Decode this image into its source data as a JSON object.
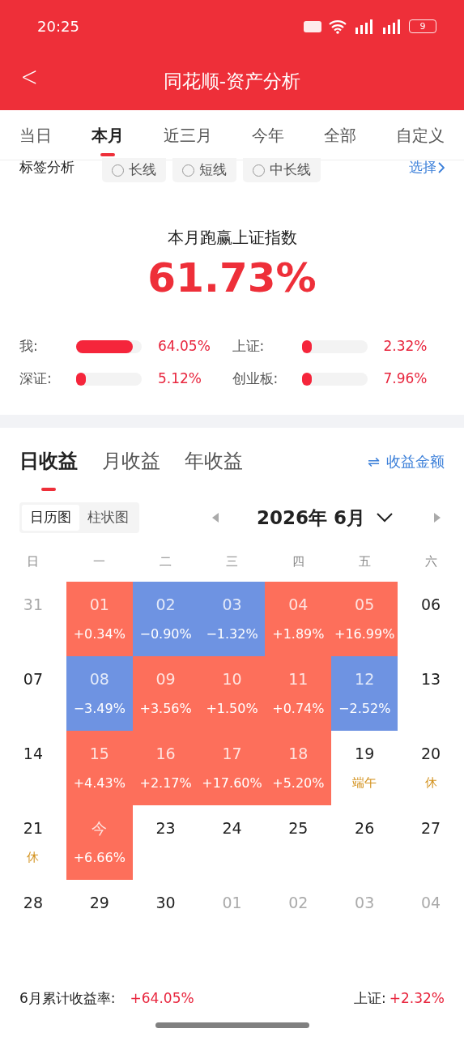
{
  "status_bar": {
    "time": "20:25",
    "battery": "9"
  },
  "header": {
    "back": "<",
    "title": "同花顺-资产分析"
  },
  "period_tabs": [
    {
      "label": "当日",
      "selected": false
    },
    {
      "label": "本月",
      "selected": true
    },
    {
      "label": "近三月",
      "selected": false
    },
    {
      "label": "今年",
      "selected": false
    },
    {
      "label": "全部",
      "selected": false
    },
    {
      "label": "自定义",
      "selected": false
    }
  ],
  "tag_filter": {
    "label": "标签分析",
    "options": [
      {
        "label": "长线",
        "checked": false
      },
      {
        "label": "短线",
        "checked": false
      },
      {
        "label": "中长线",
        "checked": false
      }
    ],
    "select": "选择"
  },
  "summary": {
    "title": "本月跑赢上证指数",
    "value": "61.73%"
  },
  "comparisons": [
    {
      "name": "我:",
      "level": 0.86,
      "value": "64.05%"
    },
    {
      "name": "上证:",
      "level": 0.15,
      "value": "2.32%"
    },
    {
      "name": "深证:",
      "level": 0.15,
      "value": "5.12%"
    },
    {
      "name": "创业板:",
      "level": 0.15,
      "value": "7.96%"
    }
  ],
  "income_tabs": [
    {
      "label": "日收益",
      "selected": true
    },
    {
      "label": "月收益",
      "selected": false
    },
    {
      "label": "年收益",
      "selected": false
    }
  ],
  "switch_link": {
    "icon": "⇌",
    "label": "收益金额"
  },
  "view_toggle": [
    {
      "label": "日历图",
      "selected": true
    },
    {
      "label": "柱状图",
      "selected": false
    }
  ],
  "month": "2026年 6月",
  "weekdays": [
    "日",
    "一",
    "二",
    "三",
    "四",
    "五",
    "六"
  ],
  "calendar": [
    {
      "day": "31",
      "kind": "other"
    },
    {
      "day": "01",
      "kind": "up",
      "change": "+0.34%"
    },
    {
      "day": "02",
      "kind": "down",
      "change": "−0.90%"
    },
    {
      "day": "03",
      "kind": "down",
      "change": "−1.32%"
    },
    {
      "day": "04",
      "kind": "up",
      "change": "+1.89%"
    },
    {
      "day": "05",
      "kind": "up",
      "change": "+16.99%"
    },
    {
      "day": "06",
      "kind": "plain"
    },
    {
      "day": "07",
      "kind": "plain"
    },
    {
      "day": "08",
      "kind": "down",
      "change": "−3.49%"
    },
    {
      "day": "09",
      "kind": "up",
      "change": "+3.56%"
    },
    {
      "day": "10",
      "kind": "up",
      "change": "+1.50%"
    },
    {
      "day": "11",
      "kind": "up",
      "change": "+0.74%"
    },
    {
      "day": "12",
      "kind": "down",
      "change": "−2.52%"
    },
    {
      "day": "13",
      "kind": "plain"
    },
    {
      "day": "14",
      "kind": "plain"
    },
    {
      "day": "15",
      "kind": "up",
      "change": "+4.43%"
    },
    {
      "day": "16",
      "kind": "up",
      "change": "+2.17%"
    },
    {
      "day": "17",
      "kind": "up",
      "change": "+17.60%"
    },
    {
      "day": "18",
      "kind": "up",
      "change": "+5.20%"
    },
    {
      "day": "19",
      "kind": "plain",
      "note": "端午"
    },
    {
      "day": "20",
      "kind": "plain",
      "note": "休"
    },
    {
      "day": "21",
      "kind": "plain",
      "note": "休"
    },
    {
      "day": "今",
      "kind": "up",
      "change": "+6.66%"
    },
    {
      "day": "23",
      "kind": "plain"
    },
    {
      "day": "24",
      "kind": "plain"
    },
    {
      "day": "25",
      "kind": "plain"
    },
    {
      "day": "26",
      "kind": "plain"
    },
    {
      "day": "27",
      "kind": "plain"
    },
    {
      "day": "28",
      "kind": "plain"
    },
    {
      "day": "29",
      "kind": "plain"
    },
    {
      "day": "30",
      "kind": "plain"
    },
    {
      "day": "01",
      "kind": "other"
    },
    {
      "day": "02",
      "kind": "other"
    },
    {
      "day": "03",
      "kind": "other"
    },
    {
      "day": "04",
      "kind": "other"
    }
  ],
  "footer": {
    "label": "6月累计收益率:",
    "value": "+64.05%",
    "index_label": "上证:",
    "index_value": "+2.32%"
  }
}
